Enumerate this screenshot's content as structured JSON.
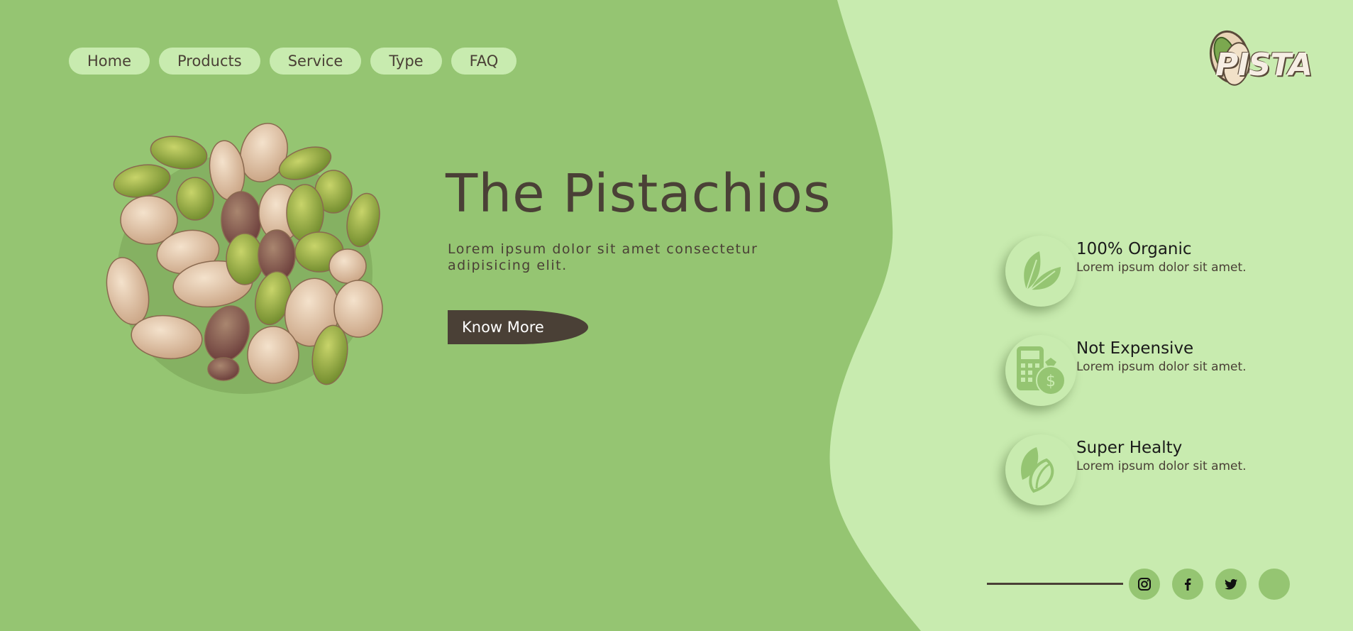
{
  "nav": {
    "items": [
      {
        "label": "Home"
      },
      {
        "label": "Products"
      },
      {
        "label": "Service"
      },
      {
        "label": "Type"
      },
      {
        "label": "FAQ"
      }
    ]
  },
  "logo": {
    "text": "PISTA"
  },
  "hero": {
    "title": "The Pistachios",
    "subtitle": "Lorem ipsum dolor sit amet consectetur adipisicing elit.",
    "cta_label": "Know More"
  },
  "features": [
    {
      "icon": "leaf-icon",
      "title": "100% Organic",
      "text": "Lorem ipsum dolor sit amet."
    },
    {
      "icon": "calculator-money-icon",
      "title": "Not Expensive",
      "text": "Lorem ipsum dolor sit amet."
    },
    {
      "icon": "pistachio-icon",
      "title": "Super Healty",
      "text": "Lorem ipsum dolor sit amet."
    }
  ],
  "social": [
    "instagram-icon",
    "facebook-icon",
    "twitter-icon",
    "blank-icon"
  ],
  "colors": {
    "primary_green": "#95c572",
    "light_green": "#c8ebaf",
    "dark_brown": "#4a4036"
  }
}
